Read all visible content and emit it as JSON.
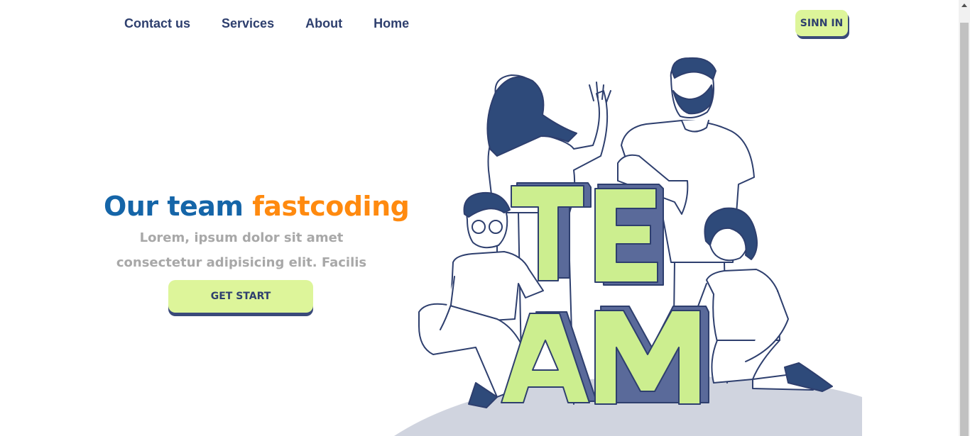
{
  "nav": {
    "links": [
      "Contact us",
      "Services",
      "About",
      "Home"
    ],
    "signin_label": "SINN IN"
  },
  "hero": {
    "title_part1": "Our team",
    "title_part2": "fastcoding",
    "description": "Lorem, ipsum dolor sit amet consectetur adipisicing elit. Facilis",
    "cta_label": "GET START"
  },
  "illustration": {
    "letters": [
      "T",
      "E",
      "A",
      "M"
    ]
  },
  "colors": {
    "nav_text": "#2e3f6e",
    "accent_green": "#ddf59a",
    "title_blue": "#1565a8",
    "title_orange": "#ff8a0f",
    "shadow_navy": "#3a4a7a",
    "muted_text": "#a8a8a8"
  }
}
